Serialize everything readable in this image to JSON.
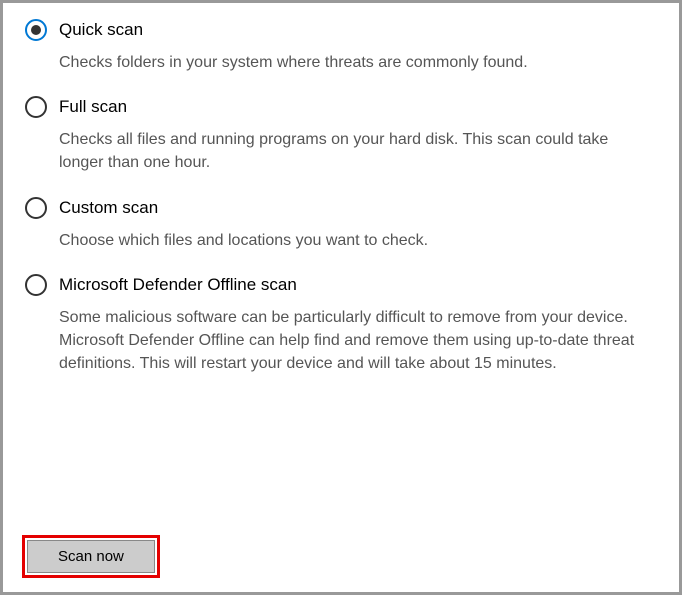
{
  "options": [
    {
      "label": "Quick scan",
      "description": "Checks folders in your system where threats are commonly found.",
      "selected": true
    },
    {
      "label": "Full scan",
      "description": "Checks all files and running programs on your hard disk. This scan could take longer than one hour.",
      "selected": false
    },
    {
      "label": "Custom scan",
      "description": "Choose which files and locations you want to check.",
      "selected": false
    },
    {
      "label": "Microsoft Defender Offline scan",
      "description": "Some malicious software can be particularly difficult to remove from your device. Microsoft Defender Offline can help find and remove them using up-to-date threat definitions. This will restart your device and will take about 15 minutes.",
      "selected": false
    }
  ],
  "actions": {
    "scan_now": "Scan now"
  }
}
